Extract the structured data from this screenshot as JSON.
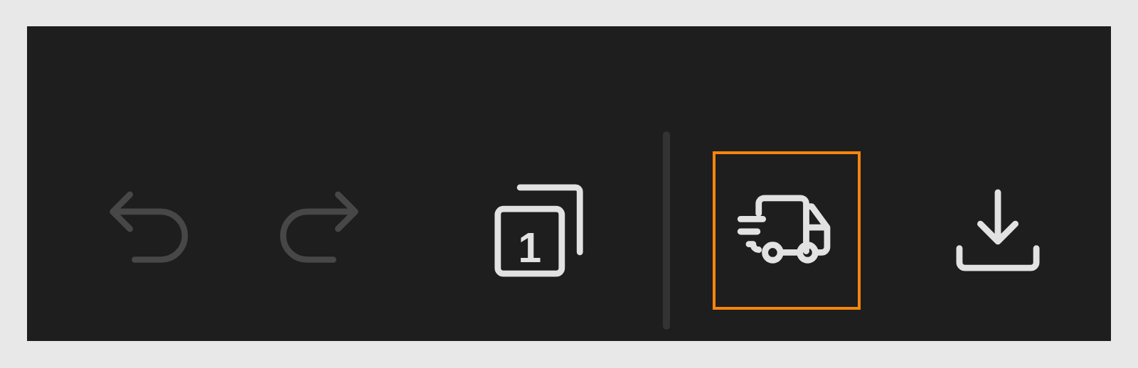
{
  "toolbar": {
    "items": [
      {
        "kind": "undo",
        "disabled": true,
        "selected": false
      },
      {
        "kind": "redo",
        "disabled": true,
        "selected": false
      },
      {
        "kind": "pages",
        "disabled": false,
        "selected": false,
        "count": "1"
      },
      {
        "kind": "separator"
      },
      {
        "kind": "delivery",
        "disabled": false,
        "selected": true
      },
      {
        "kind": "download",
        "disabled": false,
        "selected": false
      }
    ]
  }
}
